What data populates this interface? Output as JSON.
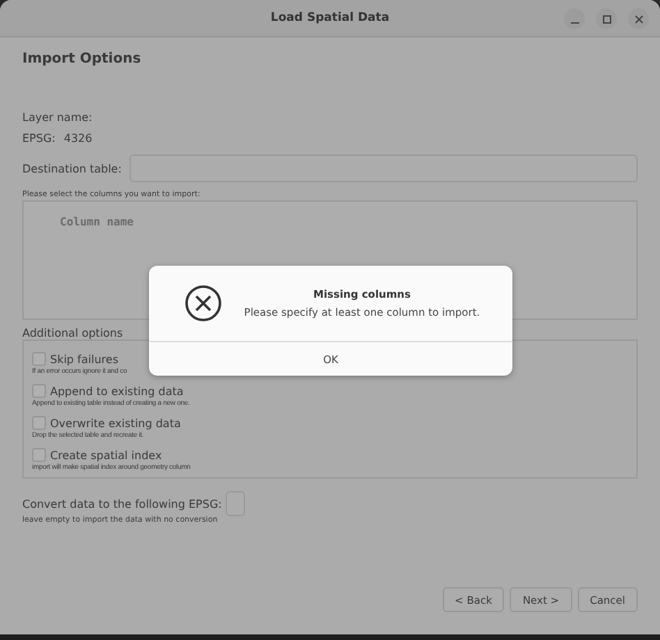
{
  "window": {
    "title": "Load Spatial Data"
  },
  "page": {
    "heading": "Import Options",
    "layer_label": "Layer name:",
    "epsg_label": "EPSG:",
    "epsg_value": "4326",
    "destination_label": "Destination table:",
    "columns_hint": "Please select the columns you want to import:",
    "columns_header": "Column name"
  },
  "additional": {
    "title": "Additional options",
    "options": [
      {
        "label": "Skip failures",
        "description": "If an error occurs ignore it and co",
        "checked": false
      },
      {
        "label": "Append to existing data",
        "description": "Append to existing table instead of creating a new one.",
        "checked": false
      },
      {
        "label": "Overwrite existing data",
        "description": "Drop the selected table and recreate it.",
        "checked": false
      },
      {
        "label": "Create spatial index",
        "description": "import will make spatial index around geometry column",
        "checked": false
      }
    ]
  },
  "convert": {
    "label": "Convert data to the following EPSG:",
    "hint": "leave empty to import the data with no conversion"
  },
  "buttons": [
    "< Back",
    "Next >",
    "Cancel"
  ],
  "dialog": {
    "title": "Missing columns",
    "message": "Please specify at least one column to import.",
    "button": "OK"
  }
}
